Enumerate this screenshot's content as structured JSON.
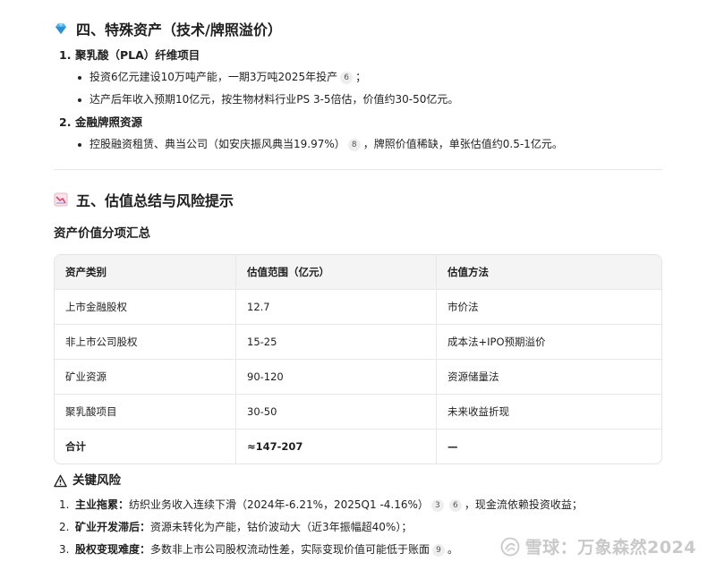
{
  "section4": {
    "title": "四、特殊资产（技术/牌照溢价）",
    "icon": "gem-icon",
    "items": [
      {
        "num": "1.",
        "title": "聚乳酸（PLA）纤维项目",
        "bullets": [
          {
            "text": "投资6亿元建设10万吨产能，一期3万吨2025年投产",
            "cite": "6",
            "tail": "；"
          },
          {
            "text": "达产后年收入预期10亿元，按生物材料行业PS 3-5倍估，价值约30-50亿元。",
            "cite": "",
            "tail": ""
          }
        ]
      },
      {
        "num": "2.",
        "title": "金融牌照资源",
        "bullets": [
          {
            "text": "控股融资租赁、典当公司（如安庆振风典当19.97%）",
            "cite": "8",
            "tail": "，牌照价值稀缺，单张估值约0.5-1亿元。"
          }
        ]
      }
    ]
  },
  "section5": {
    "title": "五、估值总结与风险提示",
    "icon": "chart-icon",
    "subtitle": "资产价值分项汇总",
    "table": {
      "headers": [
        "资产类别",
        "估值范围（亿元）",
        "估值方法"
      ],
      "rows": [
        [
          "上市金融股权",
          "12.7",
          "市价法"
        ],
        [
          "非上市公司股权",
          "15-25",
          "成本法+IPO预期溢价"
        ],
        [
          "矿业资源",
          "90-120",
          "资源储量法"
        ],
        [
          "聚乳酸项目",
          "30-50",
          "未来收益折现"
        ],
        [
          "合计",
          "≈147-207",
          "—"
        ]
      ]
    }
  },
  "risk": {
    "title": "关键风险",
    "icon": "warning-icon",
    "items": [
      {
        "num": "1.",
        "label": "主业拖累：",
        "text": "纺织业务收入连续下滑（2024年-6.21%，2025Q1 -4.16%）",
        "cites": [
          "3",
          "6"
        ],
        "tail": "，现金流依赖投资收益；"
      },
      {
        "num": "2.",
        "label": "矿业开发滞后：",
        "text": "资源未转化为产能，钴价波动大（近3年振幅超40%）；",
        "cites": [],
        "tail": ""
      },
      {
        "num": "3.",
        "label": "股权变现难度：",
        "text": "多数非上市公司股权流动性差，实际变现价值可能低于账面",
        "cites": [
          "9"
        ],
        "tail": "。"
      }
    ]
  },
  "watermark": {
    "text": "雪球：万象森然2024",
    "icon": "snowball-logo-icon"
  }
}
